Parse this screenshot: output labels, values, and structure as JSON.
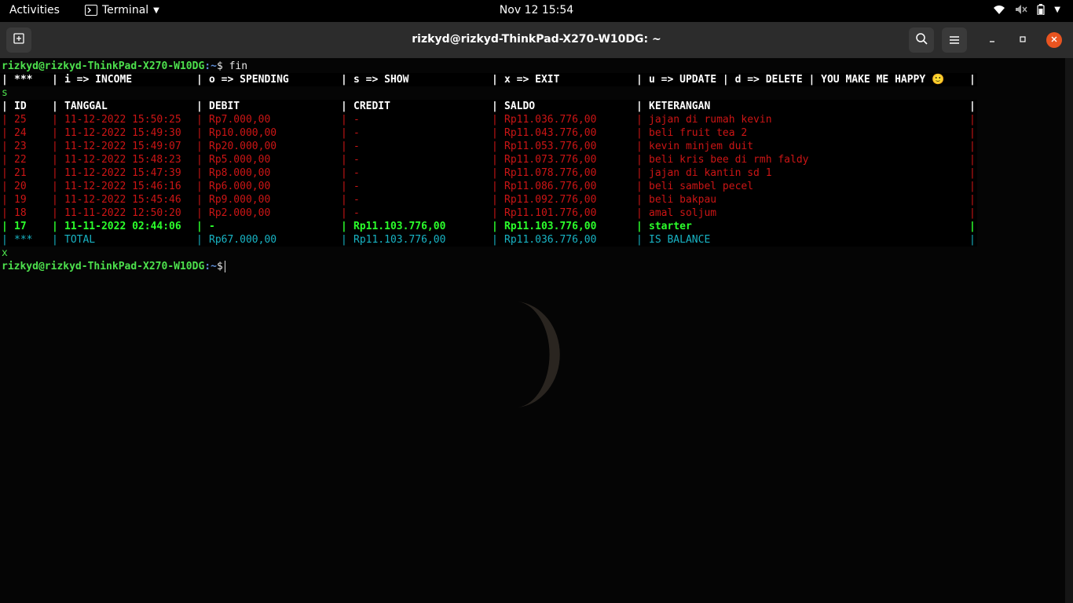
{
  "topbar": {
    "activities": "Activities",
    "app_name": "Terminal",
    "clock": "Nov 12  15:54"
  },
  "window": {
    "title": "rizkyd@rizkyd-ThinkPad-X270-W10DG: ~"
  },
  "terminal": {
    "prompt_user": "rizkyd@rizkyd-ThinkPad-X270-W10DG",
    "prompt_path": ":~",
    "prompt_symbol": "$",
    "command": " fin",
    "menu": [
      "***",
      "i => INCOME",
      "o => SPENDING",
      "s => SHOW",
      "x => EXIT",
      "u => UPDATE | d => DELETE | YOU MAKE ME HAPPY 🙂"
    ],
    "input_1": "s",
    "headers": [
      "ID",
      "TANGGAL",
      "DEBIT",
      "CREDIT",
      "SALDO",
      "KETERANGAN"
    ],
    "rows": [
      [
        "25",
        "11-12-2022 15:50:25",
        "Rp7.000,00",
        "-",
        "Rp11.036.776,00",
        "jajan di rumah kevin"
      ],
      [
        "24",
        "11-12-2022 15:49:30",
        "Rp10.000,00",
        "-",
        "Rp11.043.776,00",
        "beli fruit tea 2"
      ],
      [
        "23",
        "11-12-2022 15:49:07",
        "Rp20.000,00",
        "-",
        "Rp11.053.776,00",
        "kevin minjem duit"
      ],
      [
        "22",
        "11-12-2022 15:48:23",
        "Rp5.000,00",
        "-",
        "Rp11.073.776,00",
        "beli kris bee di rmh faldy"
      ],
      [
        "21",
        "11-12-2022 15:47:39",
        "Rp8.000,00",
        "-",
        "Rp11.078.776,00",
        "jajan di kantin sd 1"
      ],
      [
        "20",
        "11-12-2022 15:46:16",
        "Rp6.000,00",
        "-",
        "Rp11.086.776,00",
        "beli sambel pecel"
      ],
      [
        "19",
        "11-12-2022 15:45:46",
        "Rp9.000,00",
        "-",
        "Rp11.092.776,00",
        "beli bakpau"
      ],
      [
        "18",
        "11-11-2022 12:50:20",
        "Rp2.000,00",
        "-",
        "Rp11.101.776,00",
        "amal soljum"
      ]
    ],
    "starter_row": [
      "17",
      "11-11-2022 02:44:06",
      "-",
      "Rp11.103.776,00",
      "Rp11.103.776,00",
      "starter"
    ],
    "total_row": [
      "***",
      "TOTAL",
      "Rp67.000,00",
      "Rp11.103.776,00",
      "Rp11.036.776,00",
      "IS BALANCE"
    ],
    "input_2": "x"
  },
  "colors": {
    "spending_row": "#cc1515",
    "starter_row": "#2bff2b",
    "total_row": "#18b4c4",
    "prompt_user": "#4de14d",
    "prompt_path": "#5e8dd6",
    "close_button": "#e95420"
  },
  "icons": [
    "terminal-icon",
    "new-tab-icon",
    "search-icon",
    "hamburger-menu-icon",
    "minimize-icon",
    "maximize-icon",
    "close-icon",
    "wifi-icon",
    "volume-muted-icon",
    "battery-icon"
  ]
}
